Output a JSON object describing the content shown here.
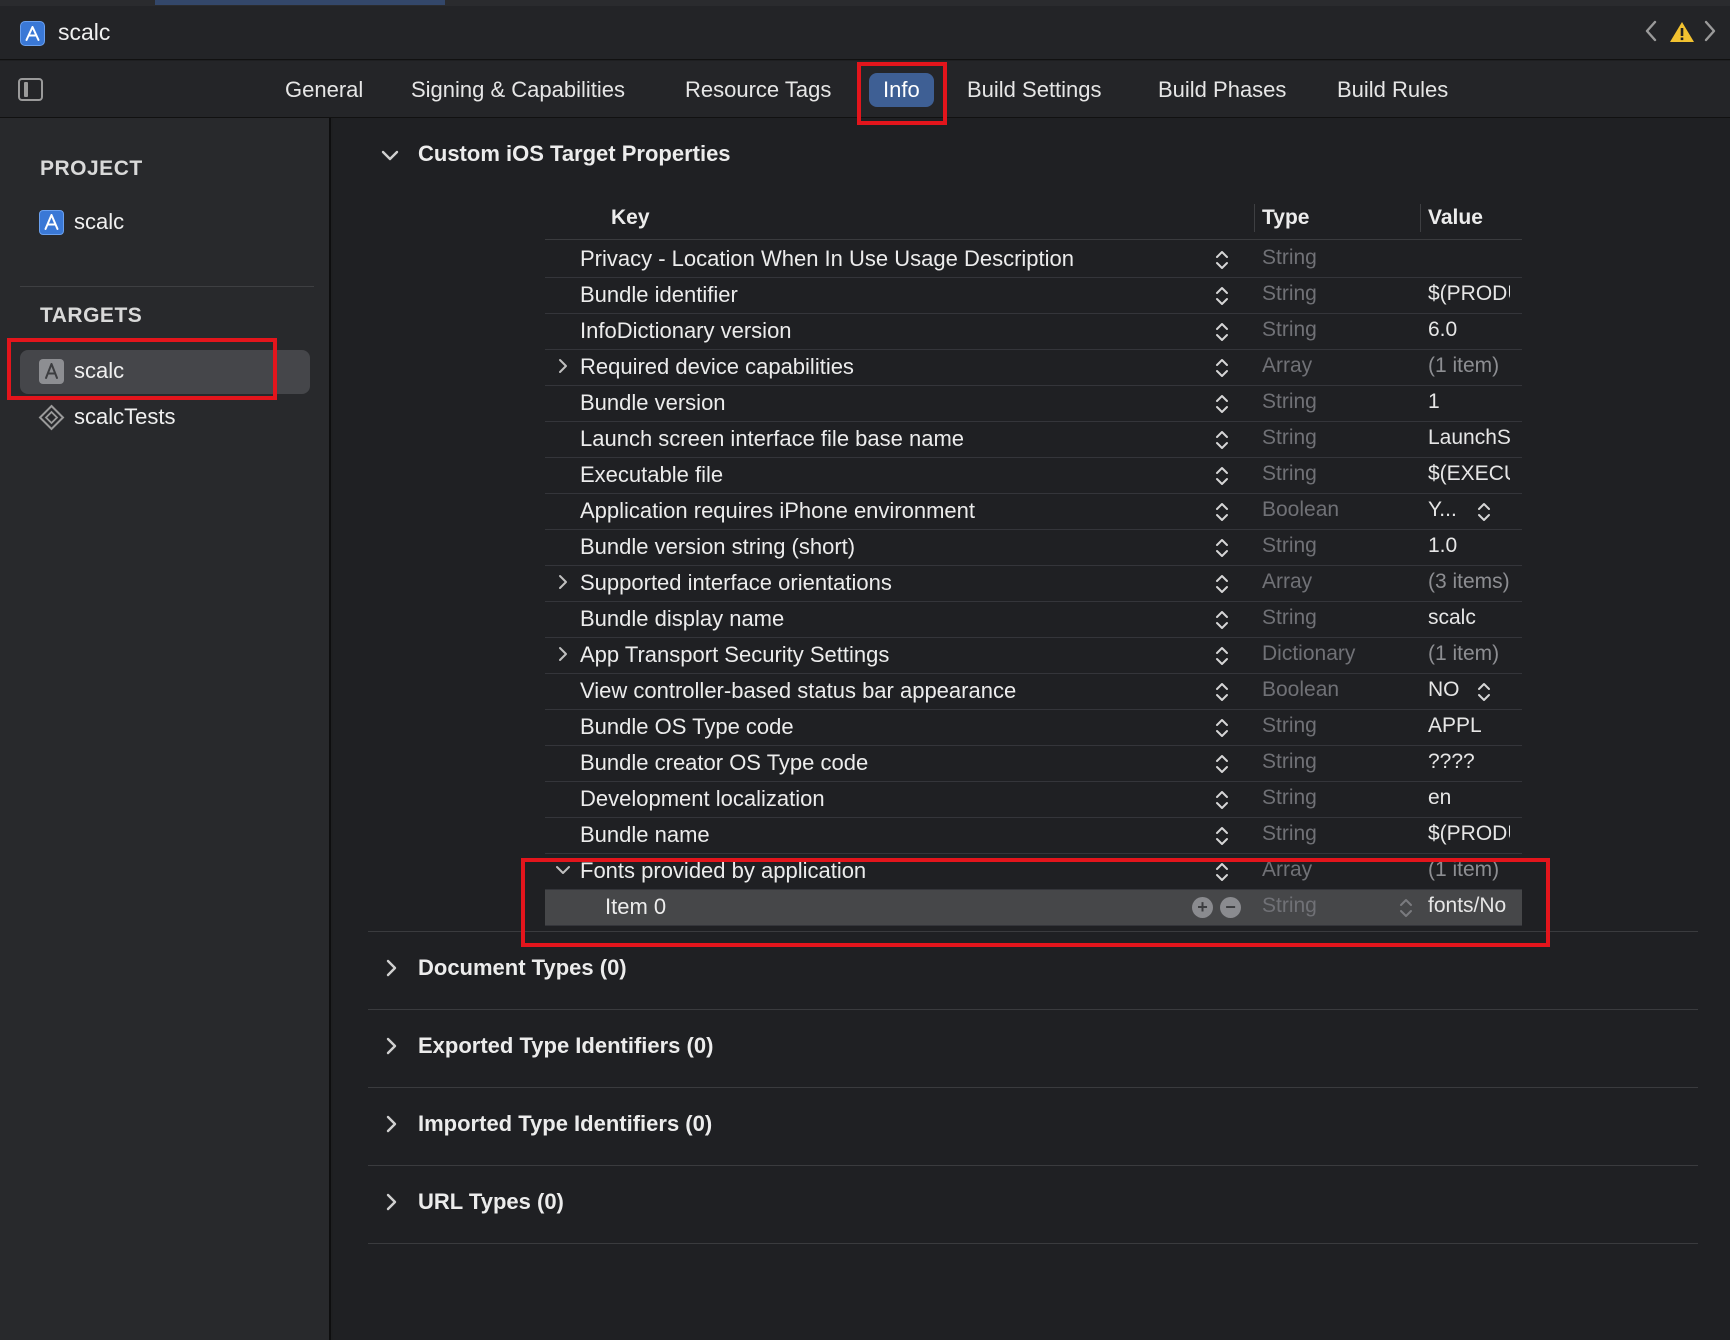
{
  "window": {
    "title": "scalc"
  },
  "tabs": [
    {
      "label": "General"
    },
    {
      "label": "Signing & Capabilities"
    },
    {
      "label": "Resource Tags"
    },
    {
      "label": "Info"
    },
    {
      "label": "Build Settings"
    },
    {
      "label": "Build Phases"
    },
    {
      "label": "Build Rules"
    }
  ],
  "sidebar": {
    "project_header": "PROJECT",
    "project_item": "scalc",
    "targets_header": "TARGETS",
    "targets": [
      {
        "label": "scalc"
      },
      {
        "label": "scalcTests"
      }
    ]
  },
  "main": {
    "custom_props_title": "Custom iOS Target Properties",
    "columns": {
      "key": "Key",
      "type": "Type",
      "value": "Value"
    },
    "rows": [
      {
        "key": "Privacy - Location When In Use Usage Description",
        "type": "String",
        "value": ""
      },
      {
        "key": "Bundle identifier",
        "type": "String",
        "value": "$(PRODUCT_BUNDLE_IDENTIFIER)"
      },
      {
        "key": "InfoDictionary version",
        "type": "String",
        "value": "6.0"
      },
      {
        "key": "Required device capabilities",
        "type": "Array",
        "value": "(1 item)"
      },
      {
        "key": "Bundle version",
        "type": "String",
        "value": "1"
      },
      {
        "key": "Launch screen interface file base name",
        "type": "String",
        "value": "LaunchScreen"
      },
      {
        "key": "Executable file",
        "type": "String",
        "value": "$(EXECUTABLE_NAME)"
      },
      {
        "key": "Application requires iPhone environment",
        "type": "Boolean",
        "value": "Y..."
      },
      {
        "key": "Bundle version string (short)",
        "type": "String",
        "value": "1.0"
      },
      {
        "key": "Supported interface orientations",
        "type": "Array",
        "value": "(3 items)"
      },
      {
        "key": "Bundle display name",
        "type": "String",
        "value": "scalc"
      },
      {
        "key": "App Transport Security Settings",
        "type": "Dictionary",
        "value": "(1 item)"
      },
      {
        "key": "View controller-based status bar appearance",
        "type": "Boolean",
        "value": "NO"
      },
      {
        "key": "Bundle OS Type code",
        "type": "String",
        "value": "APPL"
      },
      {
        "key": "Bundle creator OS Type code",
        "type": "String",
        "value": "????"
      },
      {
        "key": "Development localization",
        "type": "String",
        "value": "en"
      },
      {
        "key": "Bundle name",
        "type": "String",
        "value": "$(PRODUCT_NAME)"
      },
      {
        "key": "Fonts provided by application",
        "type": "Array",
        "value": "(1 item)"
      },
      {
        "key": "Item 0",
        "type": "String",
        "value": "fonts/No"
      }
    ],
    "sections": [
      {
        "title": "Document Types (0)"
      },
      {
        "title": "Exported Type Identifiers (0)"
      },
      {
        "title": "Imported Type Identifiers (0)"
      },
      {
        "title": "URL Types (0)"
      }
    ]
  },
  "colors": {
    "background": "#1e1f21",
    "accent": "#3e5f94",
    "highlight_box": "#e3151c",
    "warning": "#f2c230"
  }
}
